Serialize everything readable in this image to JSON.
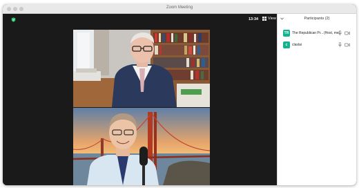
{
  "window": {
    "title": "Zoom Meeting"
  },
  "toolbar": {
    "time": "13:34",
    "view_label": "View"
  },
  "colors": {
    "security_shield": "#2fc36b",
    "avatar": "#16b28f",
    "stage_bg": "#1a1a1a"
  },
  "participants_panel": {
    "title": "Participants (2)",
    "items": [
      {
        "initials": "TR",
        "name": "The Republican Pr...",
        "role": "(Host, me)",
        "mic_icon": "mic-icon",
        "video_icon": "video-camera-icon"
      },
      {
        "initials": "c",
        "name": "claslai",
        "role": "",
        "mic_icon": "mic-icon",
        "video_icon": "video-camera-icon"
      }
    ]
  }
}
